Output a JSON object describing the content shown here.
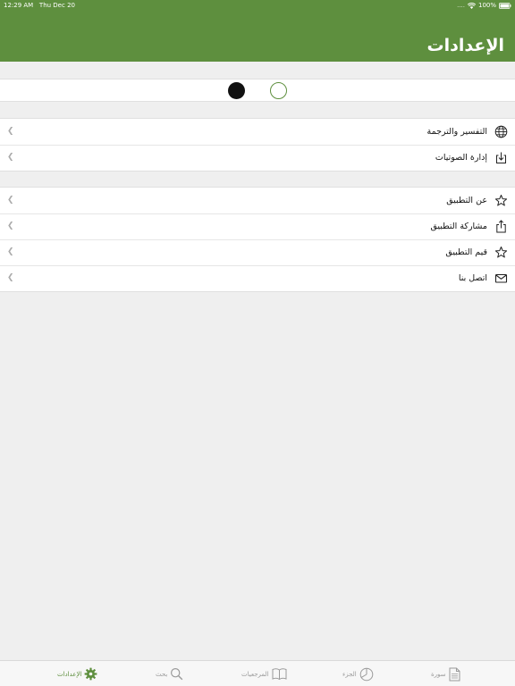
{
  "status_bar": {
    "time": "12:29 AM",
    "date": "Thu Dec 20",
    "signal": "....",
    "battery": "100%"
  },
  "header": {
    "title": "الإعدادات"
  },
  "colors": {
    "accent": "#5e8f3e",
    "background": "#efefef"
  },
  "theme_options": {
    "dark": "dark-theme",
    "light": "light-theme"
  },
  "group1": [
    {
      "label": "التفسير والترجمة",
      "icon": "globe-icon"
    },
    {
      "label": "إدارة الصوتيات",
      "icon": "download-icon"
    }
  ],
  "group2": [
    {
      "label": "عن التطبيق",
      "icon": "star-icon"
    },
    {
      "label": "مشاركة التطبيق",
      "icon": "share-icon"
    },
    {
      "label": "قيم التطبيق",
      "icon": "star-icon"
    },
    {
      "label": "اتصل بنا",
      "icon": "mail-icon"
    }
  ],
  "tabs": [
    {
      "label": "الإعدادات",
      "icon": "gear-icon",
      "active": true
    },
    {
      "label": "بحث",
      "icon": "search-icon",
      "active": false
    },
    {
      "label": "المرجعيات",
      "icon": "book-icon",
      "active": false
    },
    {
      "label": "الجزء",
      "icon": "pie-icon",
      "active": false
    },
    {
      "label": "سورة",
      "icon": "document-icon",
      "active": false
    }
  ]
}
